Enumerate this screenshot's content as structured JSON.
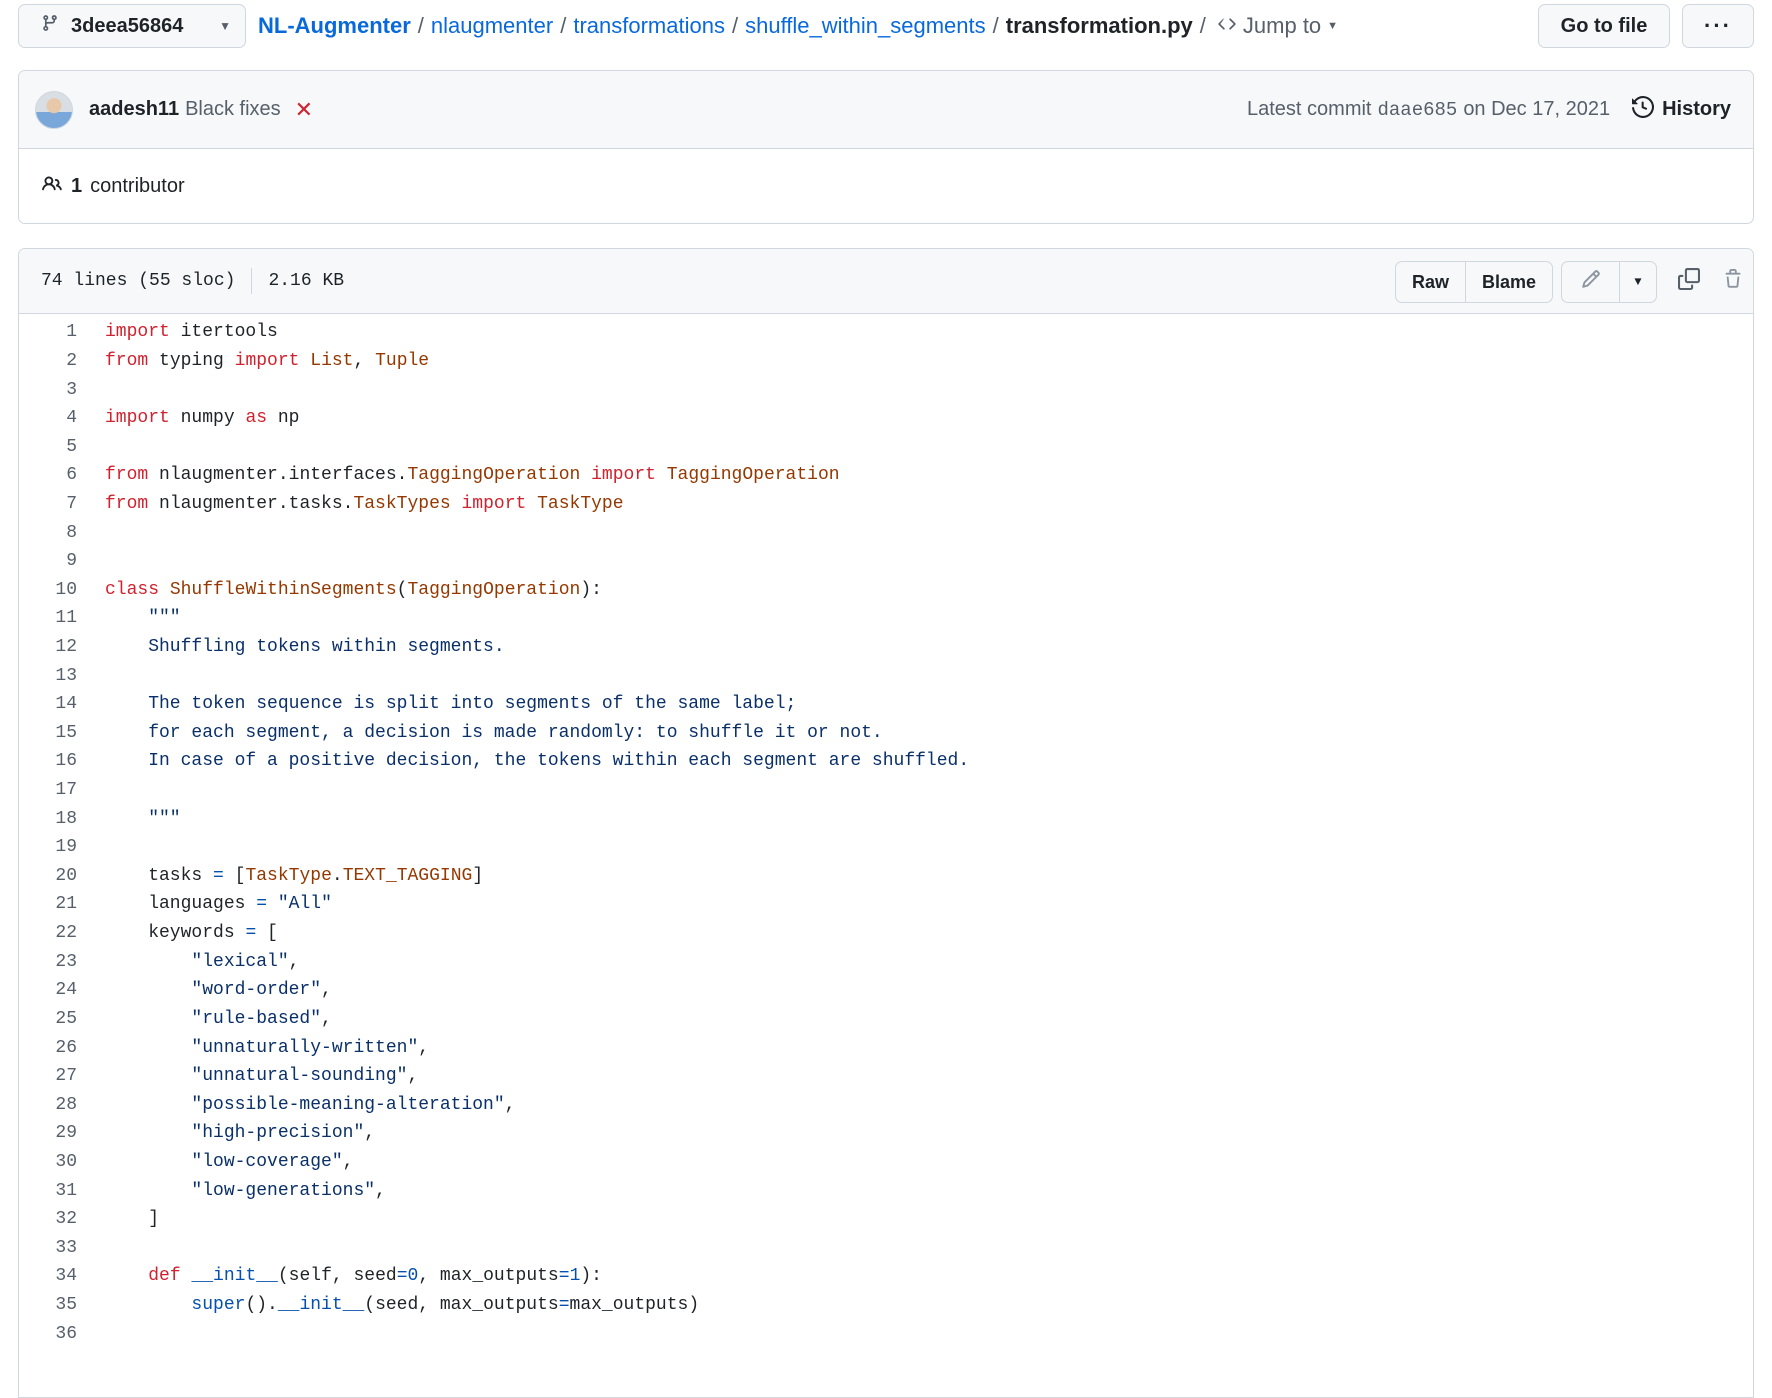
{
  "topbar": {
    "branch": "3deea56864",
    "breadcrumbs": [
      "NL-Augmenter",
      "nlaugmenter",
      "transformations",
      "shuffle_within_segments"
    ],
    "filename": "transformation.py",
    "jump_to": "Jump to",
    "goto_file": "Go to file",
    "more": "···"
  },
  "commit": {
    "author": "aadesh11",
    "message": "Black fixes",
    "status": "failed",
    "latest_label": "Latest commit",
    "sha": "daae685",
    "date": "on Dec 17, 2021",
    "history": "History"
  },
  "contributors": {
    "count": "1",
    "label": "contributor"
  },
  "file": {
    "lines_info": "74 lines (55 sloc)",
    "size": "2.16 KB",
    "raw": "Raw",
    "blame": "Blame"
  },
  "code_lines": [
    [
      [
        "kw",
        "import"
      ],
      [
        "t",
        " itertools"
      ]
    ],
    [
      [
        "kw",
        "from"
      ],
      [
        "t",
        " typing "
      ],
      [
        "kw",
        "import"
      ],
      [
        "t",
        " "
      ],
      [
        "cl",
        "List"
      ],
      [
        "t",
        ", "
      ],
      [
        "cl",
        "Tuple"
      ]
    ],
    [],
    [
      [
        "kw",
        "import"
      ],
      [
        "t",
        " numpy "
      ],
      [
        "kw",
        "as"
      ],
      [
        "t",
        " np"
      ]
    ],
    [],
    [
      [
        "kw",
        "from"
      ],
      [
        "t",
        " nlaugmenter.interfaces."
      ],
      [
        "cl",
        "TaggingOperation"
      ],
      [
        "t",
        " "
      ],
      [
        "kw",
        "import"
      ],
      [
        "t",
        " "
      ],
      [
        "cl",
        "TaggingOperation"
      ]
    ],
    [
      [
        "kw",
        "from"
      ],
      [
        "t",
        " nlaugmenter.tasks."
      ],
      [
        "cl",
        "TaskTypes"
      ],
      [
        "t",
        " "
      ],
      [
        "kw",
        "import"
      ],
      [
        "t",
        " "
      ],
      [
        "cl",
        "TaskType"
      ]
    ],
    [],
    [],
    [
      [
        "kw",
        "class"
      ],
      [
        "t",
        " "
      ],
      [
        "cl",
        "ShuffleWithinSegments"
      ],
      [
        "t",
        "("
      ],
      [
        "cl",
        "TaggingOperation"
      ],
      [
        "t",
        "):"
      ]
    ],
    [
      [
        "st",
        "    \"\"\""
      ]
    ],
    [
      [
        "st",
        "    Shuffling tokens within segments."
      ]
    ],
    [],
    [
      [
        "st",
        "    The token sequence is split into segments of the same label;"
      ]
    ],
    [
      [
        "st",
        "    for each segment, a decision is made randomly: to shuffle it or not."
      ]
    ],
    [
      [
        "st",
        "    In case of a positive decision, the tokens within each segment are shuffled."
      ]
    ],
    [],
    [
      [
        "st",
        "    \"\"\""
      ]
    ],
    [],
    [
      [
        "t",
        "    tasks "
      ],
      [
        "op",
        "="
      ],
      [
        "t",
        " ["
      ],
      [
        "cl",
        "TaskType"
      ],
      [
        "t",
        "."
      ],
      [
        "cl",
        "TEXT_TAGGING"
      ],
      [
        "t",
        "]"
      ]
    ],
    [
      [
        "t",
        "    languages "
      ],
      [
        "op",
        "="
      ],
      [
        "t",
        " "
      ],
      [
        "st",
        "\"All\""
      ]
    ],
    [
      [
        "t",
        "    keywords "
      ],
      [
        "op",
        "="
      ],
      [
        "t",
        " ["
      ]
    ],
    [
      [
        "st",
        "        \"lexical\""
      ],
      [
        "t",
        ","
      ]
    ],
    [
      [
        "st",
        "        \"word-order\""
      ],
      [
        "t",
        ","
      ]
    ],
    [
      [
        "st",
        "        \"rule-based\""
      ],
      [
        "t",
        ","
      ]
    ],
    [
      [
        "st",
        "        \"unnaturally-written\""
      ],
      [
        "t",
        ","
      ]
    ],
    [
      [
        "st",
        "        \"unnatural-sounding\""
      ],
      [
        "t",
        ","
      ]
    ],
    [
      [
        "st",
        "        \"possible-meaning-alteration\""
      ],
      [
        "t",
        ","
      ]
    ],
    [
      [
        "st",
        "        \"high-precision\""
      ],
      [
        "t",
        ","
      ]
    ],
    [
      [
        "st",
        "        \"low-coverage\""
      ],
      [
        "t",
        ","
      ]
    ],
    [
      [
        "st",
        "        \"low-generations\""
      ],
      [
        "t",
        ","
      ]
    ],
    [
      [
        "t",
        "    ]"
      ]
    ],
    [],
    [
      [
        "t",
        "    "
      ],
      [
        "kw",
        "def"
      ],
      [
        "t",
        " "
      ],
      [
        "nm",
        "__init__"
      ],
      [
        "t",
        "(self, seed"
      ],
      [
        "op",
        "="
      ],
      [
        "nm",
        "0"
      ],
      [
        "t",
        ", max_outputs"
      ],
      [
        "op",
        "="
      ],
      [
        "nm",
        "1"
      ],
      [
        "t",
        "):"
      ]
    ],
    [
      [
        "t",
        "        "
      ],
      [
        "nm",
        "super"
      ],
      [
        "t",
        "()."
      ],
      [
        "nm",
        "__init__"
      ],
      [
        "t",
        "(seed, max_outputs"
      ],
      [
        "op",
        "="
      ],
      [
        "t",
        "max_outputs)"
      ]
    ],
    []
  ],
  "icons": {
    "branch": "git-branch-icon",
    "history": "history-icon",
    "people": "people-icon",
    "edit": "pencil-icon",
    "copy": "copy-icon",
    "delete": "trash-icon",
    "status": "x-icon"
  },
  "colors": {
    "link": "#0969da",
    "keyword": "#cf222e",
    "class": "#953800",
    "string": "#0a3069",
    "number": "#0550ae",
    "failed": "#cf222e"
  }
}
